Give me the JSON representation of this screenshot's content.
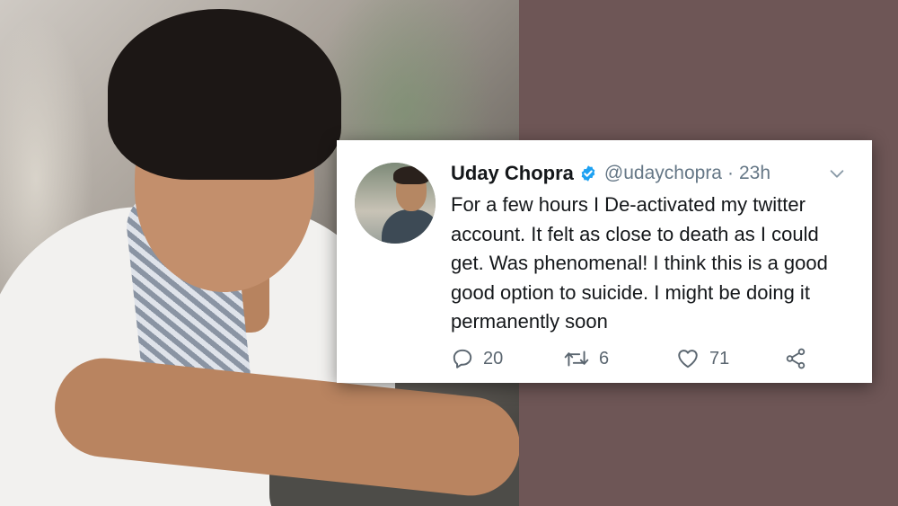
{
  "tweet": {
    "display_name": "Uday Chopra",
    "handle": "@udaychopra",
    "separator": "·",
    "time": "23h",
    "text": "For a few hours I De-activated my twitter account. It felt as close to death as I could get. Was phenomenal! I think this is a good good option to suicide. I might be doing it permanently soon",
    "replies": "20",
    "retweets": "6",
    "likes": "71"
  },
  "icons": {
    "verified": "verified-badge-icon",
    "menu": "chevron-down-icon",
    "reply": "reply-icon",
    "retweet": "retweet-icon",
    "like": "heart-icon",
    "share": "share-icon"
  },
  "colors": {
    "background": "#6e5656",
    "verified": "#1da1f2",
    "secondary_text": "#657786",
    "primary_text": "#14171a"
  }
}
